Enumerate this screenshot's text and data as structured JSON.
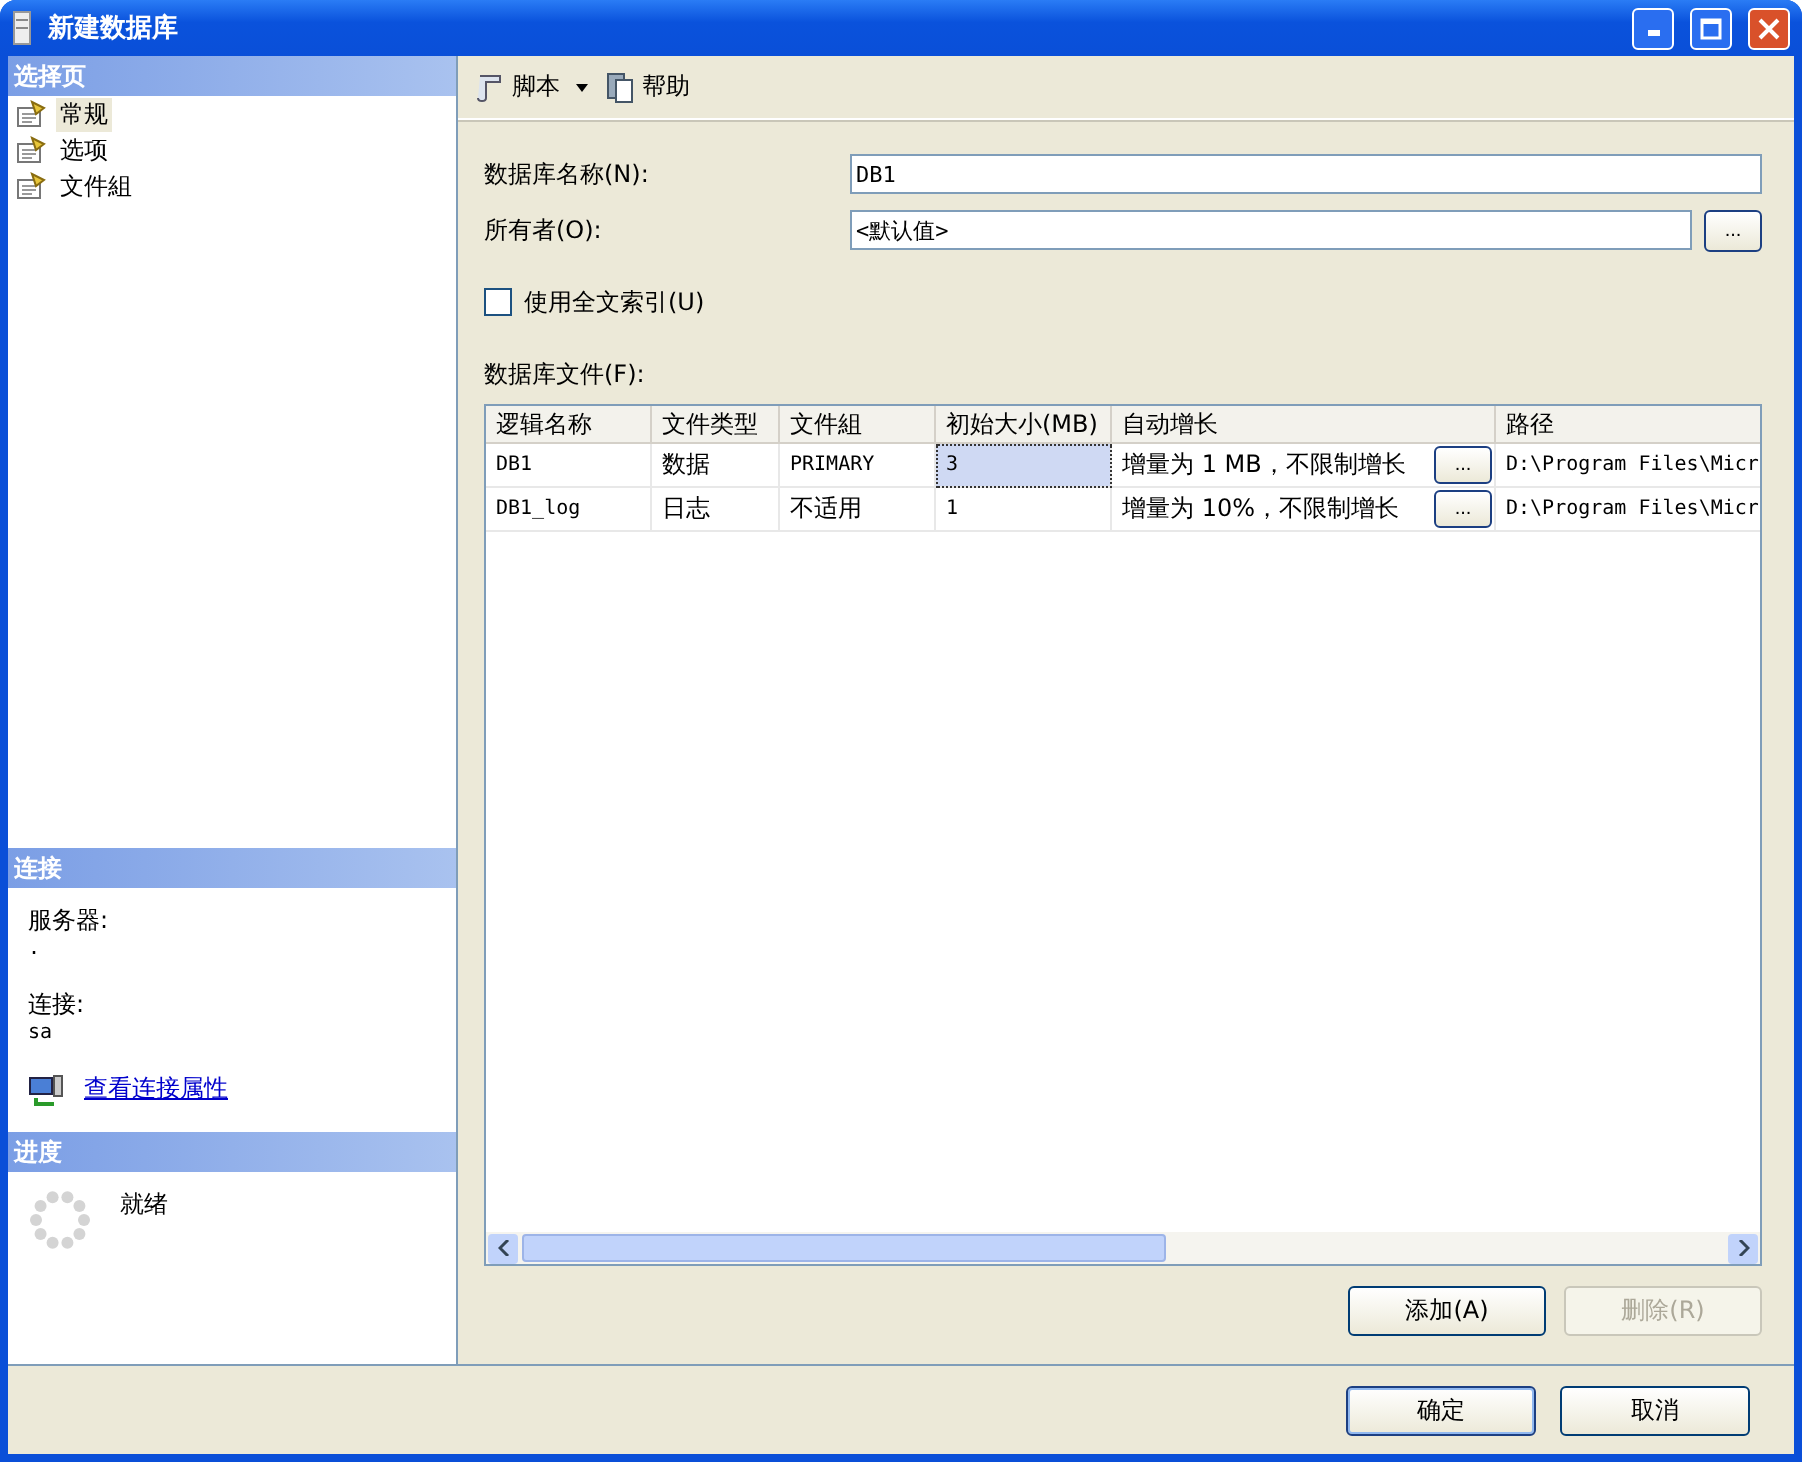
{
  "window": {
    "title": "新建数据库"
  },
  "sidebar": {
    "header": "选择页",
    "items": [
      {
        "label": "常规",
        "selected": true
      },
      {
        "label": "选项",
        "selected": false
      },
      {
        "label": "文件組",
        "selected": false
      }
    ]
  },
  "connection": {
    "header": "连接",
    "server_label": "服务器:",
    "server_value": ".",
    "connection_label": "连接:",
    "connection_value": "sa",
    "link": "查看连接属性"
  },
  "progress": {
    "header": "进度",
    "status": "就绪"
  },
  "toolbar": {
    "script": "脚本",
    "help": "帮助"
  },
  "form": {
    "name_label": "数据库名称(N):",
    "name_value": "DB1",
    "owner_label": "所有者(O):",
    "owner_value": "<默认值>",
    "owner_button": "...",
    "fulltext": {
      "label": "使用全文索引(U)",
      "checked": false
    },
    "files_label": "数据库文件(F):"
  },
  "table": {
    "columns": [
      "逻辑名称",
      "文件类型",
      "文件組",
      "初始大小(MB)",
      "自动增长",
      "路径"
    ],
    "rows": [
      {
        "name": "DB1",
        "type": "数据",
        "filegroup": "PRIMARY",
        "size": "3",
        "size_selected": true,
        "growth": "增量为 1 MB，不限制增长",
        "growth_button": "...",
        "path": "D:\\Program Files\\Micr"
      },
      {
        "name": "DB1_log",
        "type": "日志",
        "filegroup": "不适用",
        "size": "1",
        "size_selected": false,
        "growth": "增量为 10%，不限制增长",
        "growth_button": "...",
        "path": "D:\\Program Files\\Micr"
      }
    ]
  },
  "table_buttons": [
    {
      "label": "添加(A)",
      "disabled": false
    },
    {
      "label": "删除(R)",
      "disabled": true
    }
  ],
  "dialog_buttons": [
    {
      "label": "确定",
      "default": true
    },
    {
      "label": "取消",
      "default": false
    }
  ]
}
